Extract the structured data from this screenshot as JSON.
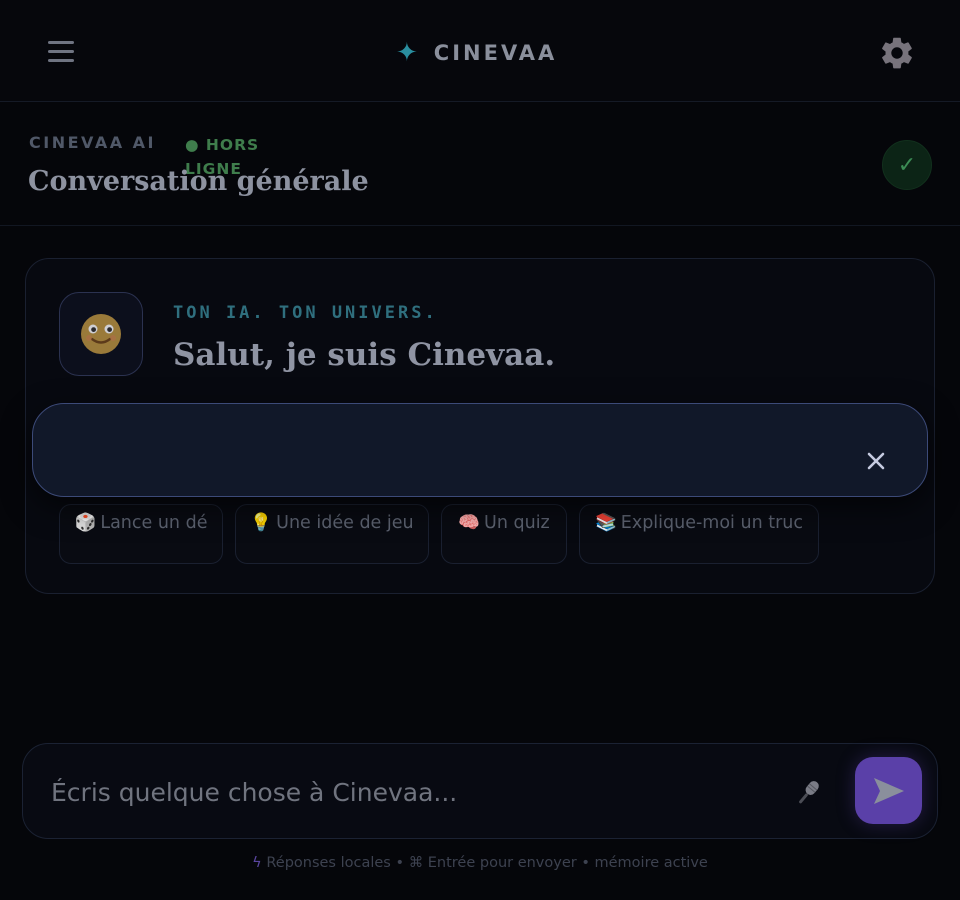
{
  "header": {
    "brand_star": "✦",
    "brand_name": "CINEVAA"
  },
  "conversation": {
    "kicker": "CINEVAA AI",
    "status": "● HORS LIGNE",
    "title": "Conversation générale",
    "status_check": "✓"
  },
  "welcome": {
    "avatar_emoji": "🙂",
    "kicker": "TON IA. TON UNIVERS.",
    "title": "Salut, je suis Cinevaa.",
    "description": "",
    "chips": [
      {
        "icon": "🎲",
        "label": "Lance un dé"
      },
      {
        "icon": "💡",
        "label": "Une idée de jeu"
      },
      {
        "icon": "🧠",
        "label": "Un quiz"
      },
      {
        "icon": "📚",
        "label": "Explique-moi un truc"
      }
    ]
  },
  "toast": {
    "message": ""
  },
  "composer": {
    "placeholder": "Écris quelque chose à Cinevaa..."
  },
  "footer": {
    "bolt": "ϟ",
    "hint": "Réponses locales • ⌘ Entrée pour envoyer • mémoire active"
  },
  "colors": {
    "accent": "#5a40a8",
    "brand_teal": "#2a8fa0",
    "status_green": "#3f7d4c",
    "background": "#05060a"
  }
}
